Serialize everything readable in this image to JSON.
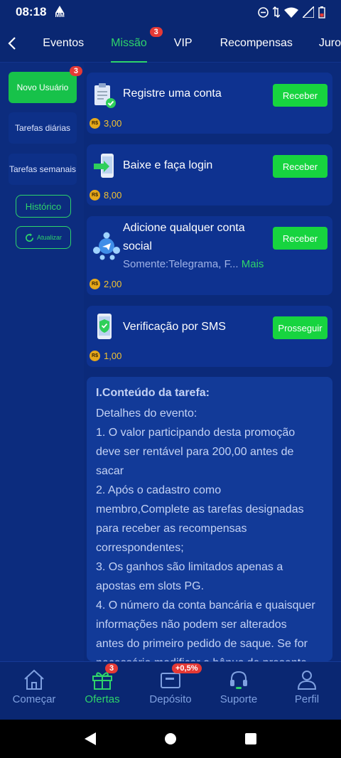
{
  "status_bar": {
    "time": "08:18",
    "mm": "MM"
  },
  "top_nav": {
    "tabs": [
      {
        "label": "Eventos"
      },
      {
        "label": "Missão",
        "badge": "3"
      },
      {
        "label": "VIP"
      },
      {
        "label": "Recompensas"
      },
      {
        "label": "Juro"
      }
    ]
  },
  "sidebar": {
    "items": [
      {
        "label": "Novo Usuário",
        "badge": "3"
      },
      {
        "label": "Tarefas diárias"
      },
      {
        "label": "Tarefas semanais"
      }
    ],
    "history_label": "Histórico",
    "refresh_label": "Atualizar"
  },
  "currency": "R$",
  "tasks": [
    {
      "title": "Registre uma conta",
      "reward": "3,00",
      "button": "Receber"
    },
    {
      "title": "Baixe e faça login",
      "reward": "8,00",
      "button": "Receber"
    },
    {
      "title_line1": "Adicione qualquer conta",
      "title_line2": "social",
      "subtitle": "Somente:Telegrama, F...",
      "more": "Mais",
      "reward": "2,00",
      "button": "Receber"
    },
    {
      "title": "Verificação por SMS",
      "reward": "1,00",
      "button": "Prosseguir"
    }
  ],
  "info": {
    "heading": "I.Conteúdo da tarefa:",
    "lines": [
      "Detalhes do evento:",
      "1. O valor participando desta promoção",
      "deve ser rentável para 200,00 antes de",
      "sacar",
      "2. Após o cadastro como",
      "membro,Complete as tarefas designadas",
      "para receber as recompensas",
      "correspondentes;",
      "3. Os ganhos são limitados apenas a",
      "apostas em slots PG.",
      "4. O número da conta bancária e quaisquer",
      "informações não podem ser alterados",
      "antes do primeiro pedido de saque. Se for",
      "necessário modificar o bônus de presente"
    ]
  },
  "bottom_nav": {
    "items": [
      {
        "label": "Começar"
      },
      {
        "label": "Ofertas",
        "badge": "3"
      },
      {
        "label": "Depósito",
        "badge": "+0,5%"
      },
      {
        "label": "Suporte"
      },
      {
        "label": "Perfil"
      }
    ]
  },
  "colors": {
    "accent": "#2ed46a",
    "button": "#17d43f",
    "background": "#0b2a7a",
    "badge": "#e53935",
    "coin": "#e6a81a"
  }
}
